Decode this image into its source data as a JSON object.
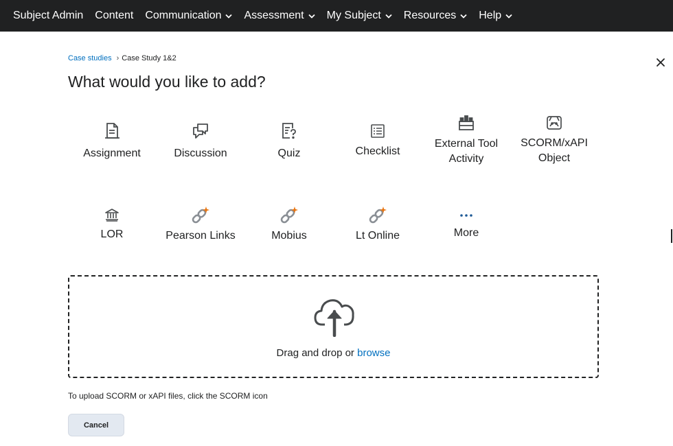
{
  "nav": {
    "items": [
      {
        "label": "Subject Admin",
        "dropdown": false
      },
      {
        "label": "Content",
        "dropdown": false
      },
      {
        "label": "Communication",
        "dropdown": true
      },
      {
        "label": "Assessment",
        "dropdown": true
      },
      {
        "label": "My Subject",
        "dropdown": true
      },
      {
        "label": "Resources",
        "dropdown": true
      },
      {
        "label": "Help",
        "dropdown": true
      }
    ]
  },
  "breadcrumb": {
    "parent": "Case studies",
    "separator": "›",
    "current": "Case Study 1&2"
  },
  "title": "What would you like to add?",
  "tiles": [
    {
      "label": "Assignment",
      "icon": "assignment-icon"
    },
    {
      "label": "Discussion",
      "icon": "discussion-icon"
    },
    {
      "label": "Quiz",
      "icon": "quiz-icon"
    },
    {
      "label": "Checklist",
      "icon": "checklist-icon"
    },
    {
      "label": "External Tool Activity",
      "icon": "external-tool-icon"
    },
    {
      "label": "SCORM/xAPI Object",
      "icon": "scorm-icon"
    },
    {
      "label": "LOR",
      "icon": "library-icon"
    },
    {
      "label": "Pearson Links",
      "icon": "link-icon"
    },
    {
      "label": "Mobius",
      "icon": "link-icon"
    },
    {
      "label": "Lt Online",
      "icon": "link-icon"
    },
    {
      "label": "More",
      "icon": "more-icon"
    }
  ],
  "dropzone": {
    "text": "Drag and drop or",
    "browse": "browse",
    "icon": "upload-cloud-icon"
  },
  "hint": "To upload SCORM or xAPI files, click the SCORM icon",
  "cancel_label": "Cancel",
  "colors": {
    "nav_bg": "#202122",
    "link": "#006fbf",
    "accent_orange": "#e87511",
    "button_bg": "#e3e9f1"
  }
}
